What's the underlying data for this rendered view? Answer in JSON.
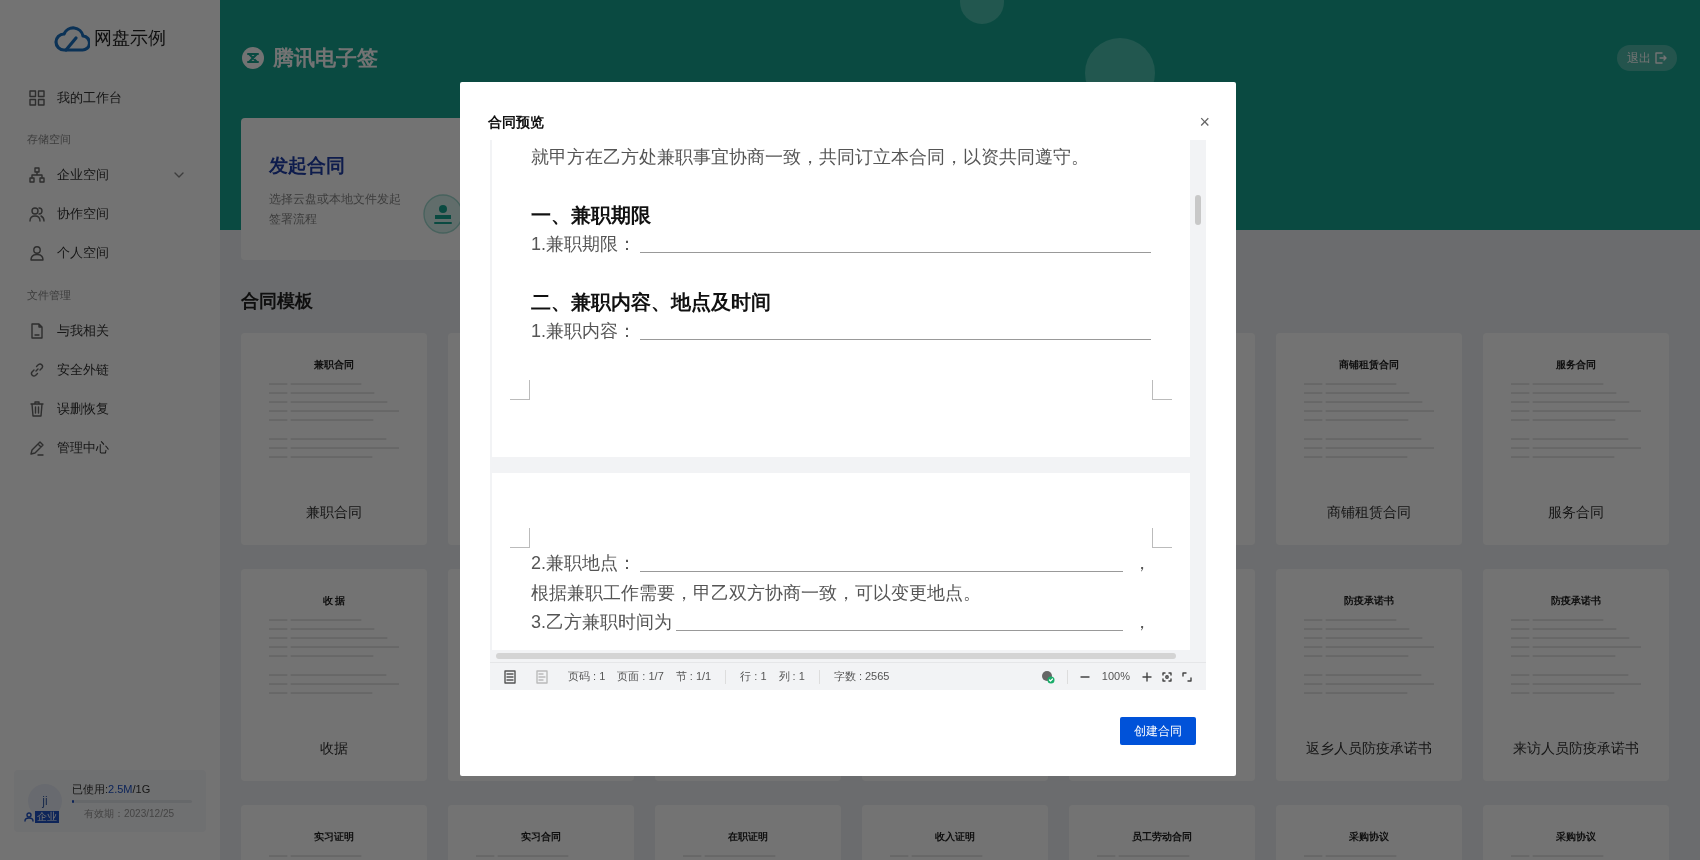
{
  "sidebar": {
    "logo": "网盘示例",
    "items": [
      {
        "kind": "item",
        "label": "我的工作台",
        "expandable": false
      },
      {
        "kind": "section",
        "label": "存储空间"
      },
      {
        "kind": "item",
        "label": "企业空间",
        "expandable": true
      },
      {
        "kind": "item",
        "label": "协作空间",
        "expandable": false
      },
      {
        "kind": "item",
        "label": "个人空间",
        "expandable": false
      },
      {
        "kind": "section",
        "label": "文件管理"
      },
      {
        "kind": "item",
        "label": "与我相关",
        "expandable": false
      },
      {
        "kind": "item",
        "label": "安全外链",
        "expandable": false
      },
      {
        "kind": "item",
        "label": "误删恢复",
        "expandable": false
      },
      {
        "kind": "item",
        "label": "管理中心",
        "expandable": false
      }
    ],
    "storage": {
      "avatar": "ji",
      "badge": "企业",
      "used_label": "已使用:",
      "used": "2.5M",
      "total": "/1G",
      "level": 0.01,
      "expiry": "有效期：2023/12/25"
    }
  },
  "header": {
    "brand": "腾讯电子签",
    "logout": "退出"
  },
  "launch_card": {
    "title": "发起合同",
    "description": "选择云盘或本地文件发起签署流程"
  },
  "templates": {
    "title": "合同模板",
    "rows": [
      [
        {
          "doc_title": "兼职合同",
          "name": "兼职合同"
        },
        {},
        {},
        {},
        {},
        {
          "doc_title": "商铺租赁合同",
          "name": "商铺租赁合同"
        },
        {
          "doc_title": "服务合同",
          "name": "服务合同"
        }
      ],
      [
        {
          "doc_title": "收 据",
          "name": "收据"
        },
        {},
        {},
        {},
        {},
        {
          "doc_title": "防疫承诺书",
          "name": "返乡人员防疫承诺书"
        },
        {
          "doc_title": "防疫承诺书",
          "name": "来访人员防疫承诺书"
        }
      ],
      [
        {
          "doc_title": "实习证明"
        },
        {
          "doc_title": "实习合同"
        },
        {
          "doc_title": "在职证明"
        },
        {
          "doc_title": "收入证明"
        },
        {
          "doc_title": "员工劳动合同"
        },
        {
          "doc_title": "采购协议"
        },
        {
          "doc_title": "采购协议"
        }
      ]
    ]
  },
  "modal": {
    "title": "合同预览",
    "close": "×",
    "pages": [
      {
        "blocks": [
          {
            "kind": "paragraph",
            "text": "就甲方在乙方处兼职事宜协商一致，共同订立本合同，以资共同遵守。"
          },
          {
            "kind": "heading",
            "text": "一、兼职期限"
          },
          {
            "kind": "field",
            "text": "1.兼职期限："
          },
          {
            "kind": "heading",
            "text": "二、兼职内容、地点及时间"
          },
          {
            "kind": "field",
            "text": "1.兼职内容："
          }
        ]
      },
      {
        "blocks": [
          {
            "kind": "field",
            "text": "2.兼职地点：",
            "after": "，"
          },
          {
            "kind": "paragraph",
            "text": "根据兼职工作需要，甲乙双方协商一致，可以变更地点。"
          },
          {
            "kind": "field",
            "text": "3.乙方兼职时间为",
            "after": "，"
          }
        ]
      }
    ],
    "status_groups": [
      [
        "页码 : 1",
        "页面 : 1/7",
        "节 : 1/1"
      ],
      [
        "行 : 1",
        "列 : 1"
      ],
      [
        "字数 : 2565"
      ]
    ],
    "zoom": "100%",
    "primary_button": "创建合同"
  }
}
